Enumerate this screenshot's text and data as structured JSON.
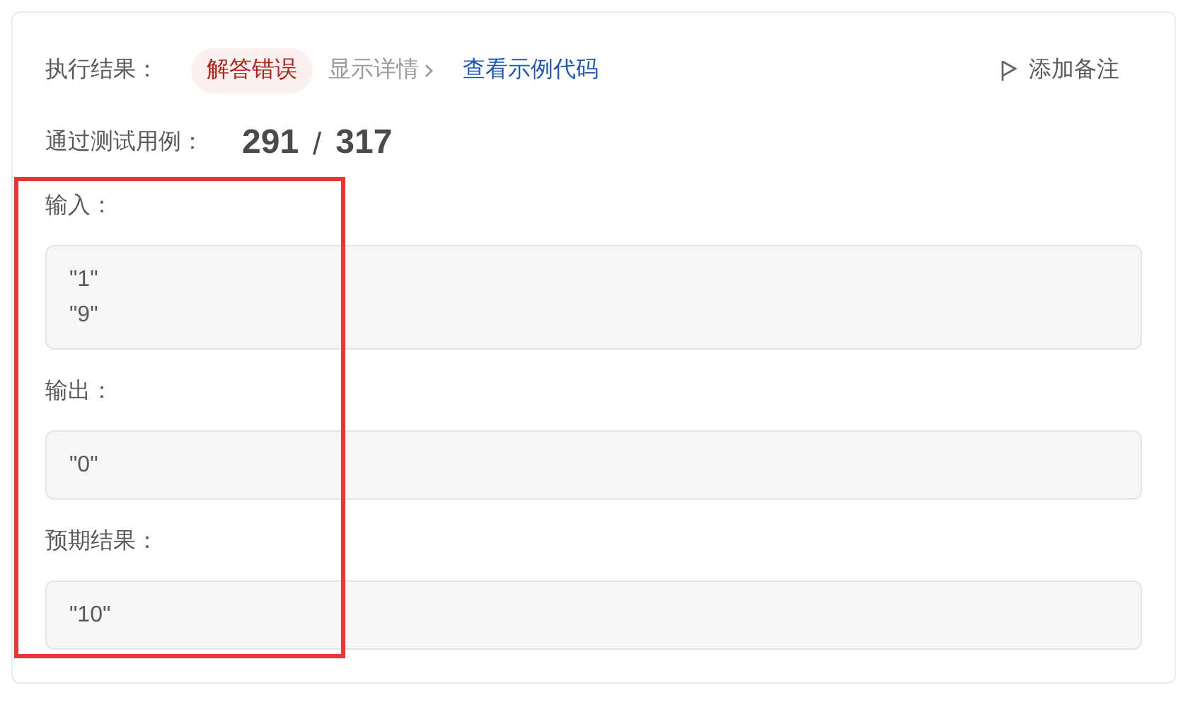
{
  "result": {
    "label": "执行结果：",
    "status": "解答错误",
    "details_link": "显示详情",
    "sample_code_link": "查看示例代码",
    "add_note": "添加备注"
  },
  "passed": {
    "label": "通过测试用例：",
    "passed": "291",
    "separator": "/",
    "total": "317"
  },
  "sections": [
    {
      "label": "输入：",
      "lines": [
        "\"1\"",
        "\"9\""
      ]
    },
    {
      "label": "输出：",
      "lines": [
        "\"0\""
      ]
    },
    {
      "label": "预期结果：",
      "lines": [
        "\"10\""
      ]
    }
  ],
  "annotation": {
    "highlighted": true
  }
}
